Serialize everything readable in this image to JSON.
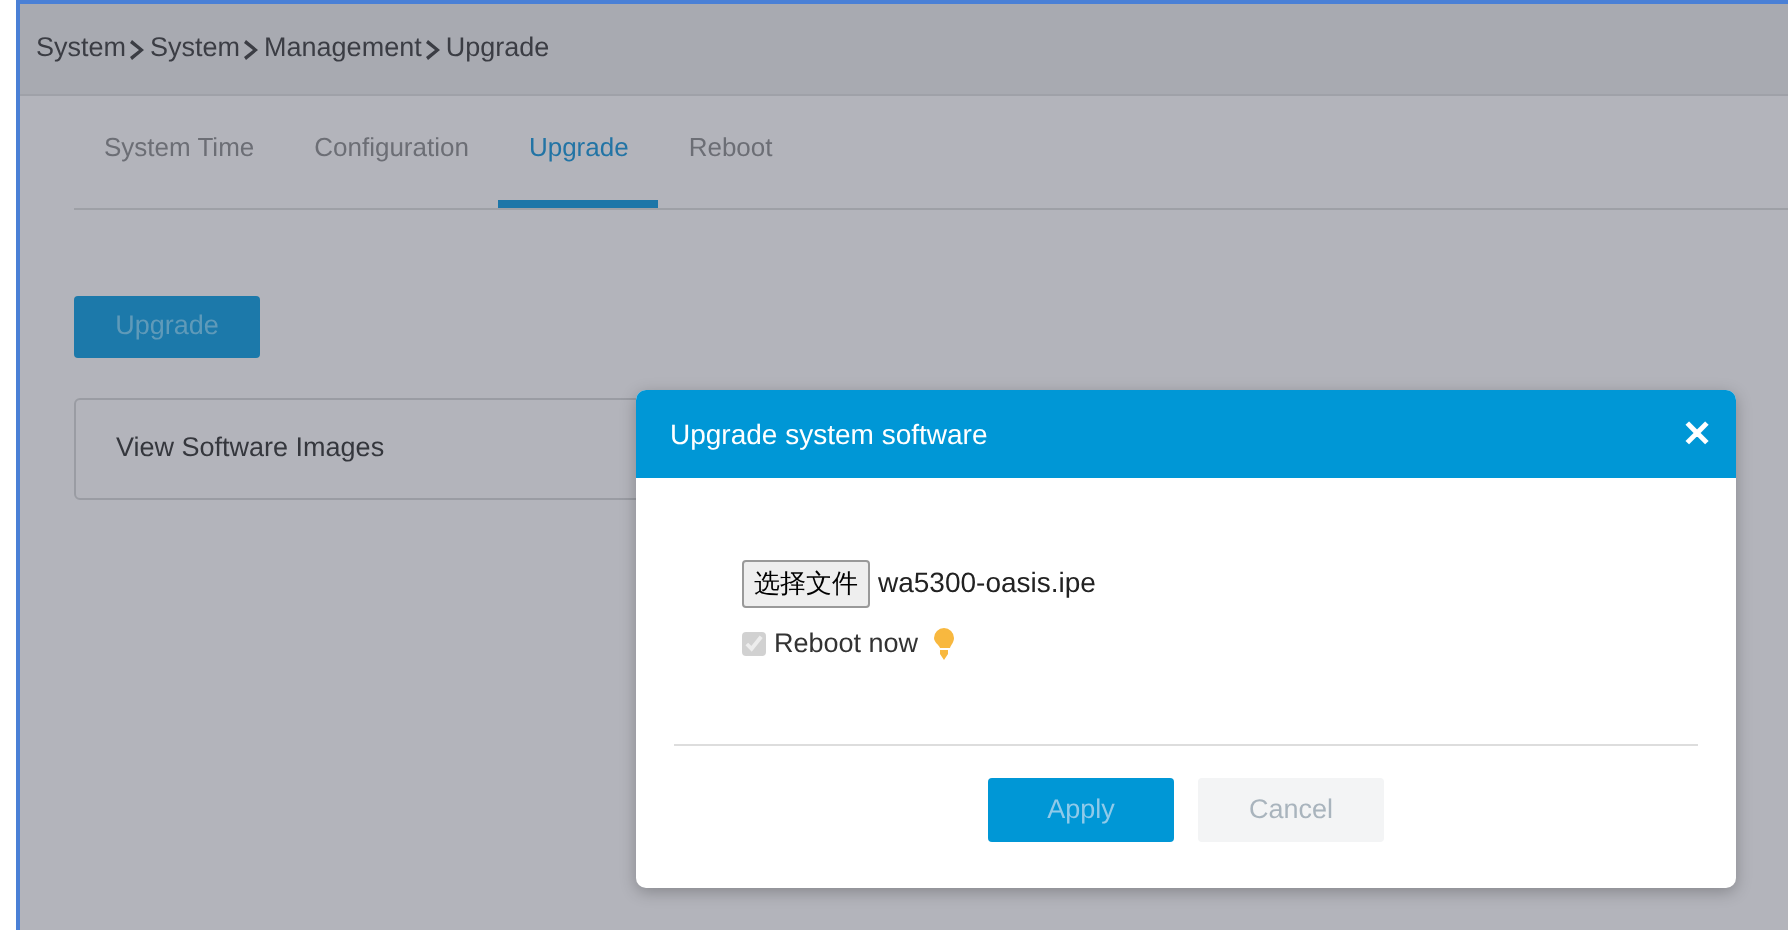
{
  "breadcrumb": [
    "System",
    "System",
    "Management",
    "Upgrade"
  ],
  "tabs": [
    {
      "label": "System Time",
      "selected": false
    },
    {
      "label": "Configuration",
      "selected": false
    },
    {
      "label": "Upgrade",
      "selected": true
    },
    {
      "label": "Reboot",
      "selected": false
    }
  ],
  "upgrade_button": "Upgrade",
  "section": {
    "title": "View Software Images"
  },
  "dialog": {
    "title": "Upgrade system software",
    "close": "✕",
    "file_button": "选择文件",
    "file_name": "wa5300-oasis.ipe",
    "reboot": {
      "label": "Reboot now",
      "checked": true
    },
    "buttons": [
      {
        "label": "Apply",
        "kind": "primary"
      },
      {
        "label": "Cancel",
        "kind": "secondary"
      }
    ]
  }
}
